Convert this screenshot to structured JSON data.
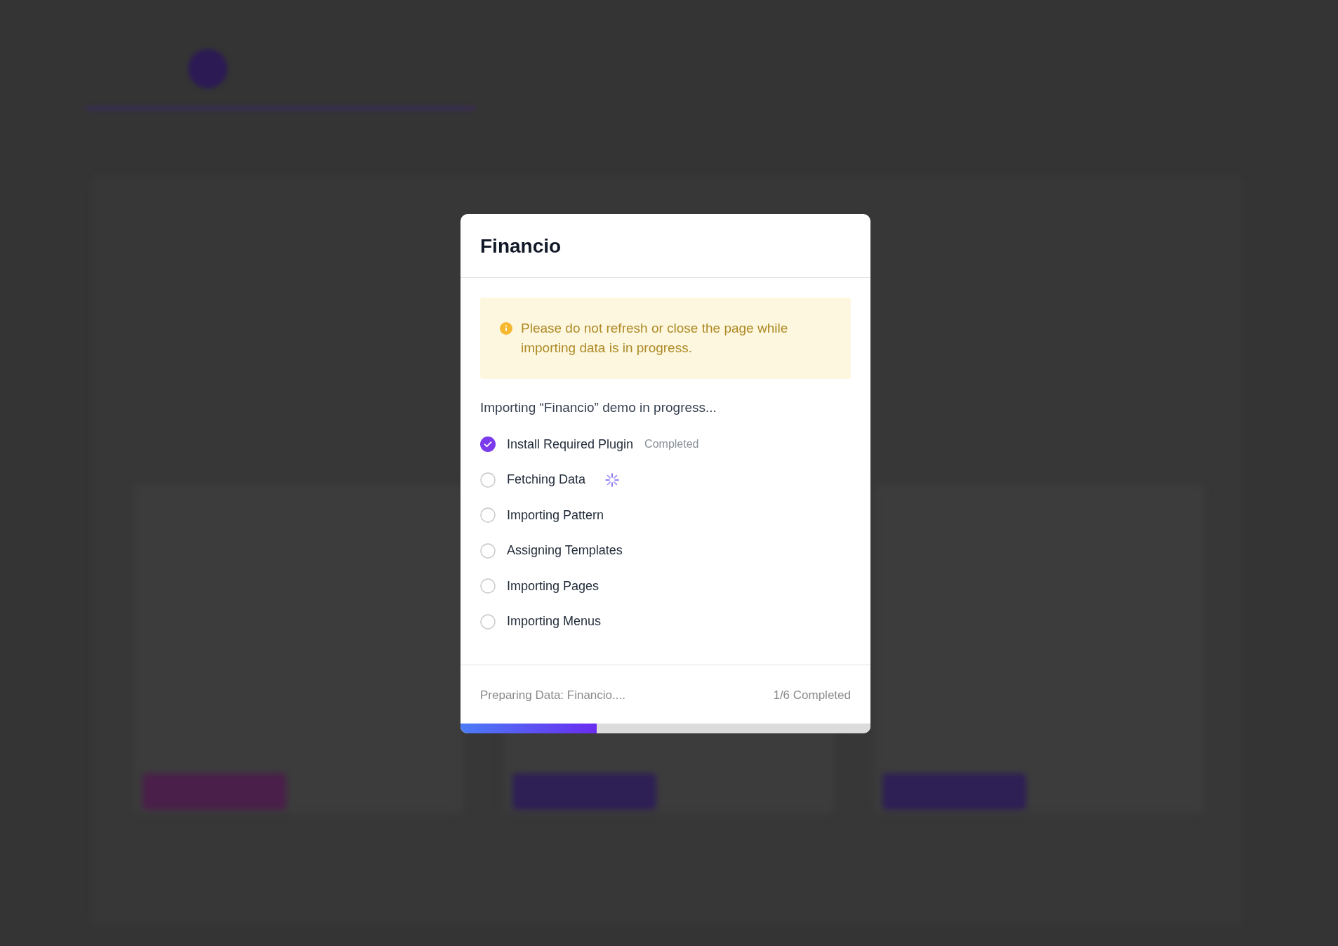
{
  "dialog": {
    "title": "Financio",
    "notice": {
      "text": "Please do not refresh or close the page while importing data is in progress."
    },
    "subtitle": "Importing “Financio” demo in progress...",
    "steps": [
      {
        "label": "Install Required Plugin",
        "completed": true,
        "loading": false,
        "note": "Completed"
      },
      {
        "label": "Fetching Data",
        "completed": false,
        "loading": true
      },
      {
        "label": "Importing Pattern",
        "completed": false,
        "loading": false
      },
      {
        "label": "Assigning Templates",
        "completed": false,
        "loading": false
      },
      {
        "label": "Importing Pages",
        "completed": false,
        "loading": false
      },
      {
        "label": "Importing Menus",
        "completed": false,
        "loading": false
      }
    ],
    "footer": {
      "message": "Preparing Data: Financio....",
      "count": "1/6 Completed"
    },
    "progress": {
      "level": 0.333
    }
  }
}
